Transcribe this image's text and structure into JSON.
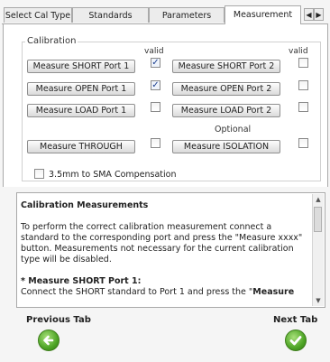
{
  "tabs": [
    {
      "label": "Select Cal Type",
      "active": false
    },
    {
      "label": "Standards",
      "active": false
    },
    {
      "label": "Parameters",
      "active": false
    },
    {
      "label": "Measurement",
      "active": true
    }
  ],
  "tab_scroll": {
    "left": "◀",
    "right": "▶"
  },
  "calibration": {
    "legend": "Calibration",
    "valid_header_left": "valid",
    "valid_header_right": "valid",
    "optional_label": "Optional",
    "buttons": {
      "short_port1": "Measure SHORT Port 1",
      "open_port1": "Measure OPEN Port 1",
      "load_port1": "Measure LOAD Port 1",
      "short_port2": "Measure SHORT Port 2",
      "open_port2": "Measure OPEN Port 2",
      "load_port2": "Measure LOAD Port 2",
      "through": "Measure THROUGH",
      "isolation": "Measure ISOLATION"
    },
    "checks": {
      "short_port1": true,
      "open_port1": true,
      "load_port1": false,
      "short_port2": false,
      "open_port2": false,
      "load_port2": false,
      "through": false,
      "isolation": false
    },
    "check_glyph": "✓",
    "sma_compensation": {
      "label": "3.5mm to SMA Compensation",
      "checked": false
    }
  },
  "description": {
    "title": "Calibration Measurements",
    "paragraph": "To perform the correct calibration measurement connect a standard to the corresponding port and press the \"Measure xxxx\" button. Measurements not necessary for the current calibration type will be disabled.",
    "step_title": "* Measure SHORT Port 1:",
    "step_text": "Connect the SHORT standard to Port 1 and press the \"",
    "step_bold": "Measure"
  },
  "scrollbar": {
    "up": "▲",
    "down": "▼"
  },
  "nav": {
    "previous_label": "Previous Tab",
    "next_label": "Next Tab",
    "previous_icon": "←",
    "next_icon": "✓"
  },
  "colors": {
    "nav_green": "#4ea526",
    "check_blue": "#1b3e8f"
  }
}
